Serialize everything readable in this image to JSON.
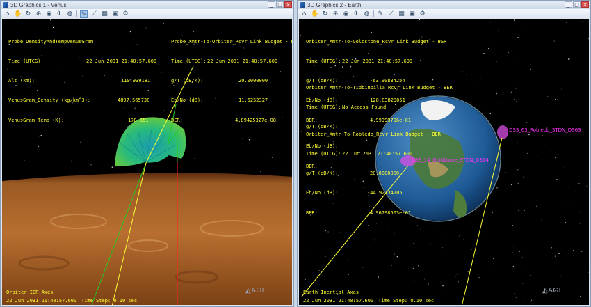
{
  "windows": [
    {
      "title": "3D Graphics 1 - Venus",
      "report1": {
        "title": "Probe DensityAndTempVenusGram",
        "rows": [
          {
            "label": "Time (UTCG):",
            "value": "22 Jun 2031 21:40:57.600"
          },
          {
            "label": "Alt (km):",
            "value": "110.939181"
          },
          {
            "label": "VenusGram_Density (kg/km^3):",
            "value": "4897.565738"
          },
          {
            "label": "VenusGram_Temp (K):",
            "value": "178.651"
          }
        ]
      },
      "report2": {
        "title": "Probe_Xmtr-To-Orbiter_Rcvr Link Budget - BER",
        "rows": [
          {
            "label": "Time (UTCG):",
            "value": "22 Jun 2031 21:40:57.600"
          },
          {
            "label": "g/T (dB/K):",
            "value": "20.0000000"
          },
          {
            "label": "Eb/No (dB):",
            "value": "11.5252327"
          },
          {
            "label": "BER:",
            "value": "4.89425327e-08"
          }
        ]
      },
      "axes_label": "Orbiter ICR Axes",
      "footer_time": "22 Jun 2031 21:40:57.600",
      "footer_step": "Time Step: 0.10 sec",
      "logo": "AGI"
    },
    {
      "title": "3D Graphics 2 - Earth",
      "reports": [
        {
          "title": "Orbiter_Xmtr-To-Goldstone_Rcvr Link Budget - BER",
          "rows": [
            {
              "label": "Time (UTCG):",
              "value": "22 Jun 2031 21:40:57.600"
            },
            {
              "label": "g/T (dB/K):",
              "value": "-63.90834254"
            },
            {
              "label": "Eb/No (dB):",
              "value": "-128.83829051"
            },
            {
              "label": "BER:",
              "value": "4.99999796e-01"
            }
          ]
        },
        {
          "title": "Orbiter_Xmtr-To-Tidbinbilla_Rcvr Link Budget - BER",
          "rows": [
            {
              "label": "Time (UTCG):",
              "value": "No Access Found"
            },
            {
              "label": "g/T (dB/K):",
              "value": ""
            },
            {
              "label": "Eb/No (dB):",
              "value": ""
            },
            {
              "label": "BER:",
              "value": ""
            }
          ]
        },
        {
          "title": "Orbiter_Xmtr-To-Robledo_Rcvr Link Budget - BER",
          "rows": [
            {
              "label": "Time (UTCG):",
              "value": "22 Jun 2031 21:40:57.600"
            },
            {
              "label": "g/T (dB/K):",
              "value": "20.0000000"
            },
            {
              "label": "Eb/No (dB):",
              "value": "-44.92134705"
            },
            {
              "label": "BER:",
              "value": "4.96798503e-01"
            }
          ]
        }
      ],
      "station1": "DSS_63_Robledo_STDN_DS63",
      "station2": "DSS_14_Goldstone_STDN_DS14",
      "axes_label": "Earth Inertial Axes",
      "footer_time": "22 Jun 2031 21:40:57.600",
      "footer_step": "Time Step: 0.10 sec",
      "logo": "AGI"
    }
  ],
  "toolbar_icons": [
    "home-icon",
    "pan-icon",
    "rotate-icon",
    "zoom-icon",
    "view-icon",
    "fly-icon",
    "globe-icon",
    "pick-icon",
    "measure-icon",
    "properties-icon",
    "capture-icon"
  ],
  "window_buttons": {
    "minimize": "_",
    "maximize": "□",
    "close": "×"
  },
  "colors": {
    "overlay_text": "#ffff33",
    "station": "#ff33ff",
    "link_line": "#ffff33",
    "green_line": "#22cc22",
    "red_line": "#ff2222"
  }
}
